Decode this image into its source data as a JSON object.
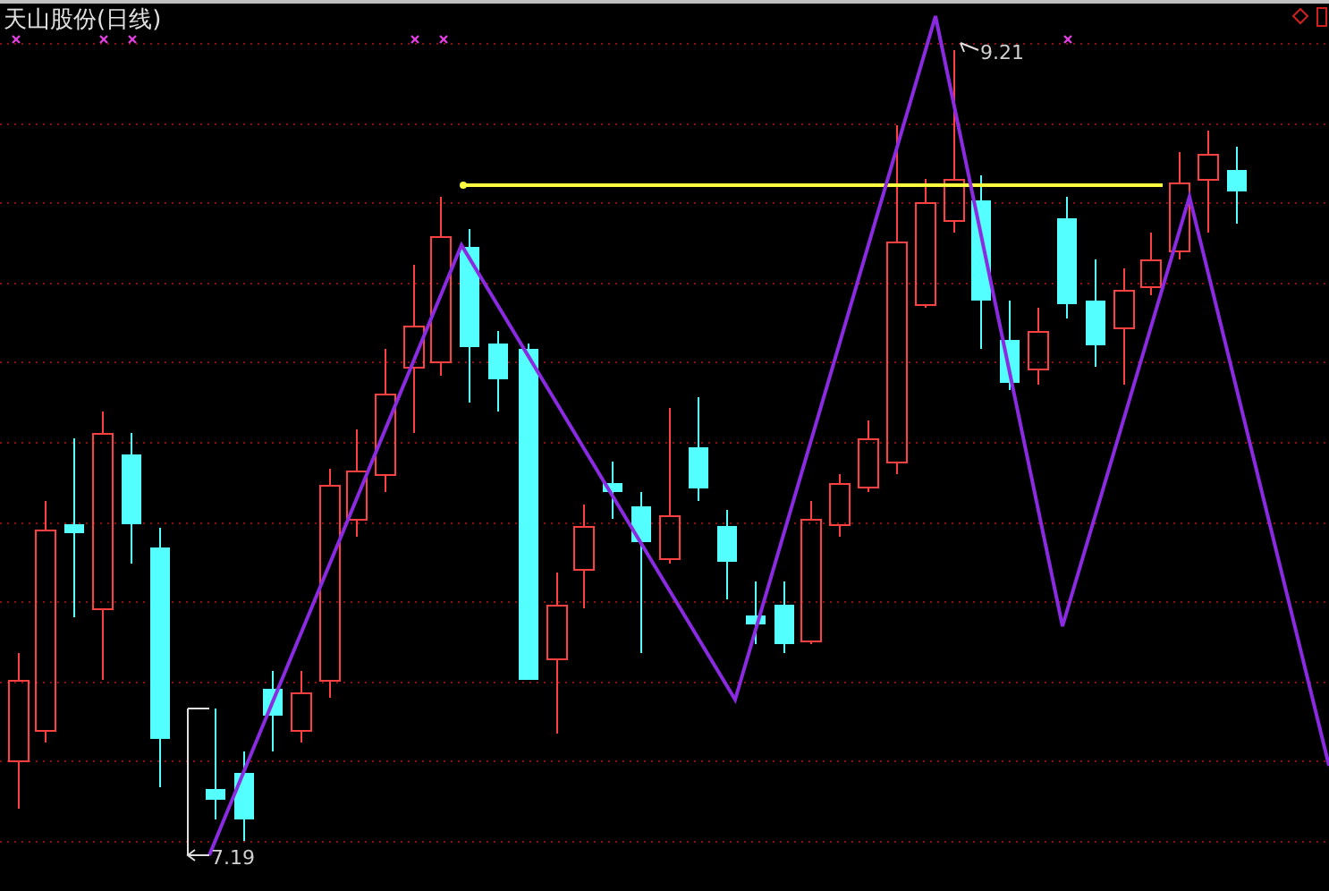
{
  "chart": {
    "title": "天山股份(日线)",
    "high_label": "9.21",
    "low_label": "7.19"
  }
}
